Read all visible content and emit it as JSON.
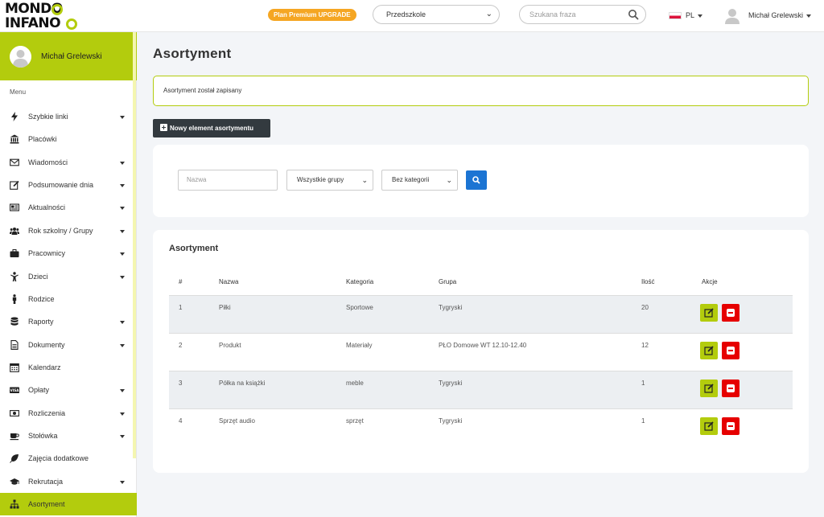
{
  "header": {
    "logo_line1": "MONDO",
    "logo_line2": "INFANO",
    "premium_label": "Plan Premium UPGRADE",
    "group_select_value": "Przedszkole",
    "search_placeholder": "Szukana fraza",
    "language": "PL",
    "user_name": "Michał Grelewski",
    "accent_color": "#b3cc0d"
  },
  "sidebar": {
    "profile_name": "Michał Grelewski",
    "menu_label": "Menu",
    "items": [
      {
        "label": "Szybkie linki",
        "icon": "bolt-icon",
        "has_submenu": true
      },
      {
        "label": "Placówki",
        "icon": "bank-icon",
        "has_submenu": false
      },
      {
        "label": "Wiadomości",
        "icon": "envelope-icon",
        "has_submenu": true
      },
      {
        "label": "Podsumowanie dnia",
        "icon": "edit-icon",
        "has_submenu": true
      },
      {
        "label": "Aktualności",
        "icon": "newspaper-icon",
        "has_submenu": true
      },
      {
        "label": "Rok szkolny / Grupy",
        "icon": "users-icon",
        "has_submenu": true
      },
      {
        "label": "Pracownicy",
        "icon": "briefcase-icon",
        "has_submenu": true
      },
      {
        "label": "Dzieci",
        "icon": "child-icon",
        "has_submenu": true
      },
      {
        "label": "Rodzice",
        "icon": "male-icon",
        "has_submenu": false
      },
      {
        "label": "Raporty",
        "icon": "database-icon",
        "has_submenu": true
      },
      {
        "label": "Dokumenty",
        "icon": "file-icon",
        "has_submenu": true
      },
      {
        "label": "Kalendarz",
        "icon": "calendar-icon",
        "has_submenu": false
      },
      {
        "label": "Opłaty",
        "icon": "visa-icon",
        "has_submenu": true
      },
      {
        "label": "Rozliczenia",
        "icon": "money-icon",
        "has_submenu": true
      },
      {
        "label": "Stołówka",
        "icon": "coffee-icon",
        "has_submenu": true
      },
      {
        "label": "Zajęcia dodatkowe",
        "icon": "leaf-icon",
        "has_submenu": false
      },
      {
        "label": "Rekrutacja",
        "icon": "graduation-cap-icon",
        "has_submenu": true
      },
      {
        "label": "Asortyment",
        "icon": "sitemap-icon",
        "has_submenu": false,
        "active": true
      }
    ]
  },
  "main": {
    "title": "Asortyment",
    "alert_text": "Asortyment został zapisany",
    "new_button_label": "Nowy element asortymentu",
    "filters": {
      "name_placeholder": "Nazwa",
      "group_select": "Wszystkie grupy",
      "category_select": "Bez kategorii"
    },
    "table": {
      "title": "Asortyment",
      "columns": [
        "#",
        "Nazwa",
        "Kategoria",
        "Grupa",
        "Ilość",
        "Akcje"
      ],
      "rows": [
        {
          "no": "1",
          "name": "Piłki",
          "category": "Sportowe",
          "group": "Tygryski",
          "qty": "20"
        },
        {
          "no": "2",
          "name": "Produkt",
          "category": "Materiały",
          "group": "PŁO Domowe WT 12.10-12.40",
          "qty": "12"
        },
        {
          "no": "3",
          "name": "Półka na książki",
          "category": "meble",
          "group": "Tygryski",
          "qty": "1"
        },
        {
          "no": "4",
          "name": "Sprzęt audio",
          "category": "sprzęt",
          "group": "Tygryski",
          "qty": "1"
        }
      ]
    }
  }
}
